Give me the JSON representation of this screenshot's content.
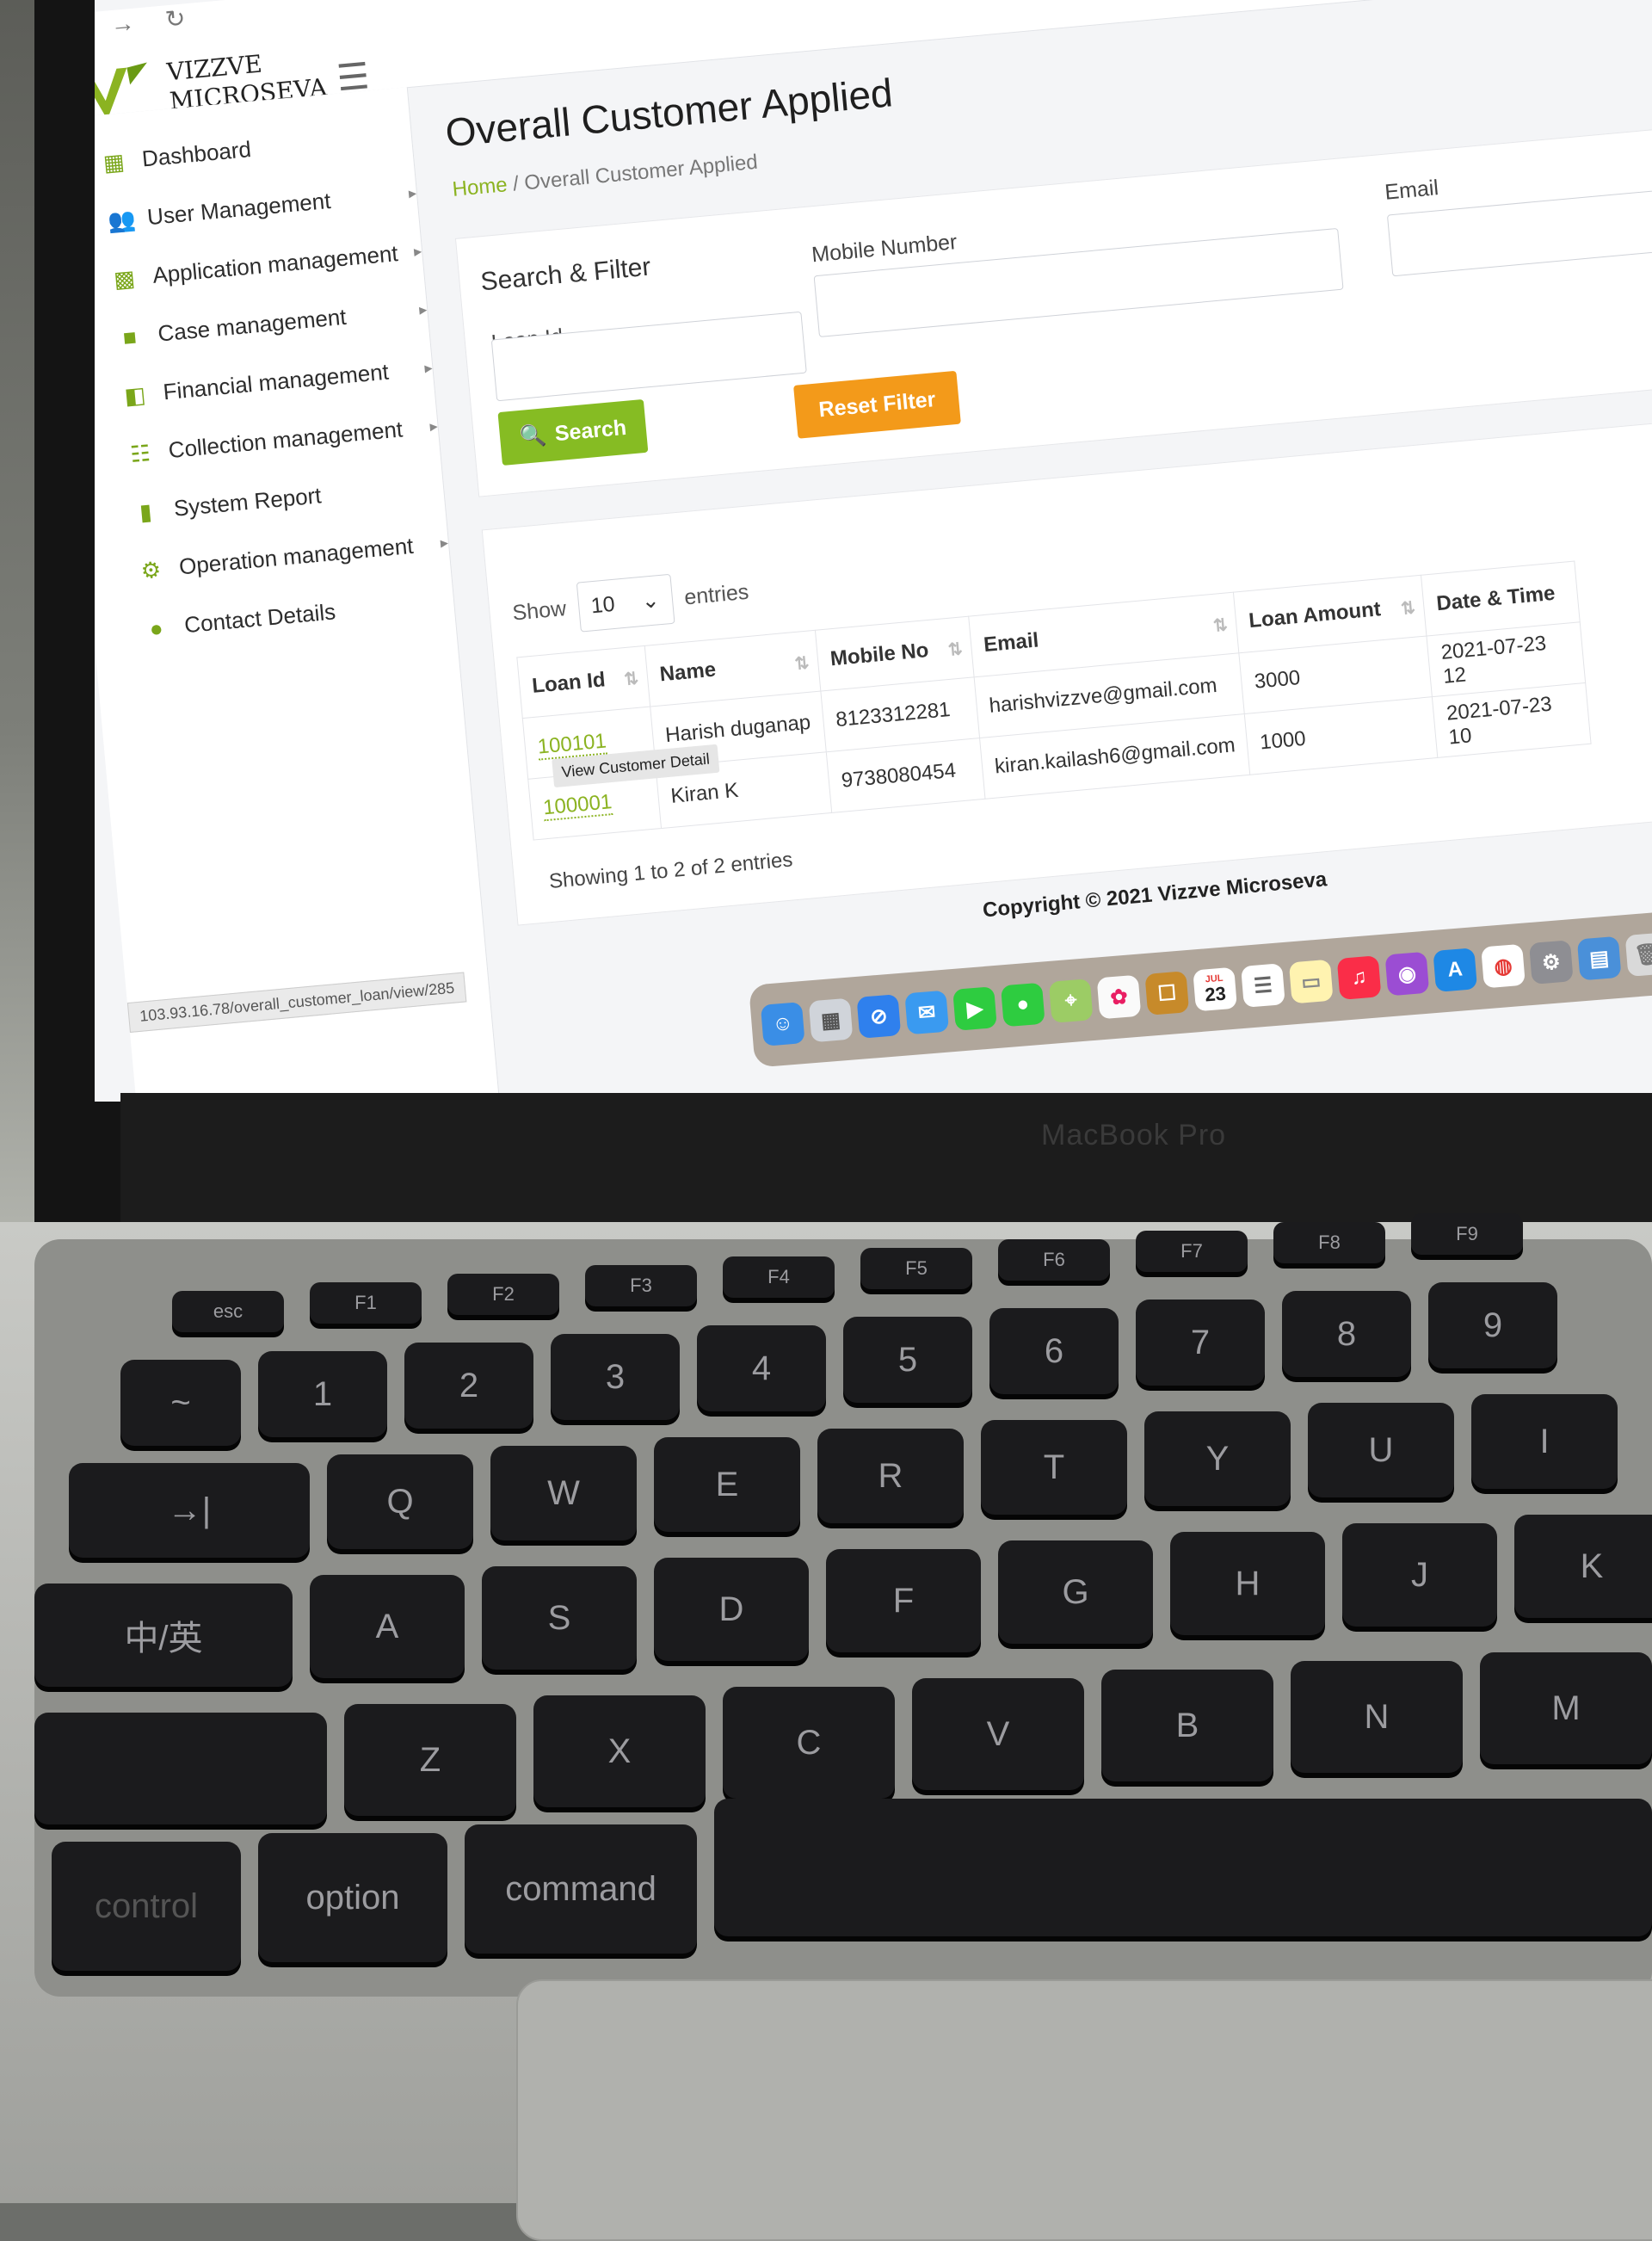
{
  "app": {
    "logo_line1": "VIZZVE",
    "logo_line2": "MICROSEVA",
    "brand_color": "#8bb321",
    "accent_orange": "#f39a1a"
  },
  "sidebar": {
    "items": [
      {
        "label": "Dashboard",
        "icon": "calendar-icon",
        "has_caret": false
      },
      {
        "label": "User Management",
        "icon": "users-icon",
        "has_caret": true
      },
      {
        "label": "Application management",
        "icon": "grid-icon",
        "has_caret": true
      },
      {
        "label": "Case management",
        "icon": "briefcase-icon",
        "has_caret": true
      },
      {
        "label": "Financial management",
        "icon": "money-icon",
        "has_caret": true
      },
      {
        "label": "Collection management",
        "icon": "list-icon",
        "has_caret": true
      },
      {
        "label": "System Report",
        "icon": "bookmark-icon",
        "has_caret": false
      },
      {
        "label": "Operation management",
        "icon": "gear-icon",
        "has_caret": true
      },
      {
        "label": "Contact Details",
        "icon": "user-icon",
        "has_caret": false
      }
    ]
  },
  "header": {
    "title": "Overall Customer Applied",
    "breadcrumb_home": "Home",
    "breadcrumb_sep": "/",
    "breadcrumb_current": "Overall Customer Applied"
  },
  "filter": {
    "title": "Search & Filter",
    "loan_id_label": "Loan Id",
    "mobile_label": "Mobile Number",
    "email_label": "Email",
    "search_label": "Search",
    "reset_label": "Reset Filter"
  },
  "table": {
    "show_label": "Show",
    "entries_label": "entries",
    "page_size": "10",
    "columns": [
      "Loan Id",
      "Name",
      "Mobile No",
      "Email",
      "Loan Amount",
      "Date & Time"
    ],
    "rows": [
      {
        "loan_id": "100101",
        "name": "Harish duganap",
        "mobile": "8123312281",
        "email": "harishvizzve@gmail.com",
        "amount": "3000",
        "datetime": "2021-07-23 12"
      },
      {
        "loan_id": "100001",
        "name": "Kiran K",
        "mobile": "9738080454",
        "email": "kiran.kailash6@gmail.com",
        "amount": "1000",
        "datetime": "2021-07-23 10"
      }
    ],
    "tooltip": "View Customer Detail",
    "showing_text": "Showing 1 to 2 of 2 entries"
  },
  "footer": {
    "copyright": "Copyright © 2021 Vizzve Microseva"
  },
  "status_bar": {
    "url": "103.93.16.78/overall_customer_loan/view/285"
  },
  "laptop": {
    "model_label": "MacBook Pro",
    "dock_calendar_day": "23",
    "dock_calendar_month": "JUL"
  },
  "keyboard": {
    "fn_row": [
      "esc",
      "F1",
      "F2",
      "F3",
      "F4",
      "F5",
      "F6",
      "F7",
      "F8",
      "F9"
    ],
    "num_row": [
      "~",
      "1",
      "2",
      "3",
      "4",
      "5",
      "6",
      "7",
      "8",
      "9"
    ],
    "q_row": [
      "→|",
      "Q",
      "W",
      "E",
      "R",
      "T",
      "Y",
      "U",
      "I"
    ],
    "a_row": [
      "中/英",
      "A",
      "S",
      "D",
      "F",
      "G",
      "H",
      "J",
      "K"
    ],
    "z_row": [
      "Z",
      "X",
      "C",
      "V",
      "B",
      "N",
      "M"
    ],
    "bottom_row": [
      "control",
      "option",
      "command"
    ]
  }
}
